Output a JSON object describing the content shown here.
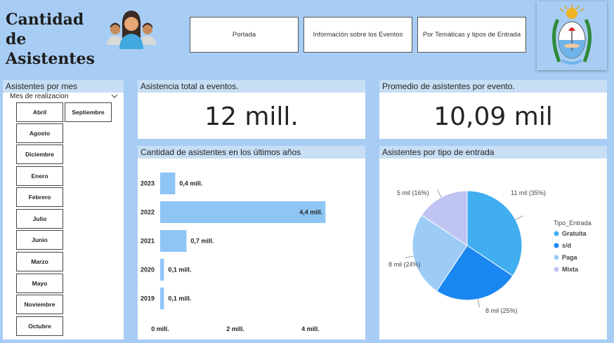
{
  "header": {
    "title_line1": "Cantidad de",
    "title_line2": "Asistentes",
    "nav": [
      "Portada",
      "Información sobre los Eventos",
      "Por Temáticas y tipos de Entrada"
    ]
  },
  "slicer": {
    "panel_title": "Asistentes por mes",
    "field_label": "Mes de realizacion",
    "months": [
      "Abril",
      "Septiembre",
      "Agosto",
      "Diciembre",
      "Enero",
      "Febrero",
      "Julio",
      "Junio",
      "Marzo",
      "Mayo",
      "Noviembre",
      "Octubre"
    ]
  },
  "kpi_total": {
    "title": "Asistencia total a eventos.",
    "value": "12 mill."
  },
  "kpi_avg": {
    "title": "Promedio de asistentes por evento.",
    "value": "10,09 mil"
  },
  "chart_data": [
    {
      "type": "bar",
      "orientation": "horizontal",
      "title": "Cantidad de asistentes en los últimos años",
      "categories": [
        "2023",
        "2022",
        "2021",
        "2020",
        "2019"
      ],
      "values": [
        0.4,
        4.4,
        0.7,
        0.1,
        0.1
      ],
      "data_labels": [
        "0,4 mill.",
        "4,4 mill.",
        "0,7 mill.",
        "0,1 mill.",
        "0,1 mill."
      ],
      "xticks": [
        0,
        2,
        4
      ],
      "xtick_labels": [
        "0 mill.",
        "2 mill.",
        "4 mill."
      ],
      "xlim": [
        0,
        4.6
      ],
      "color": "#8ec5f5"
    },
    {
      "type": "pie",
      "title": "Asistentes por tipo de entrada",
      "legend_title": "Tipo_Entrada",
      "legend_position": "right",
      "slices": [
        {
          "name": "Gratuita",
          "value": 11,
          "label": "11 mil (35%)",
          "color": "#41aef0"
        },
        {
          "name": "s/d",
          "value": 8,
          "label": "8 mil (25%)",
          "color": "#1a86f0"
        },
        {
          "name": "Paga",
          "value": 8,
          "label": "8 mil (24%)",
          "color": "#9ccbf5"
        },
        {
          "name": "Mixta",
          "value": 5,
          "label": "5 mil (16%)",
          "color": "#c0c4f2"
        }
      ]
    }
  ]
}
